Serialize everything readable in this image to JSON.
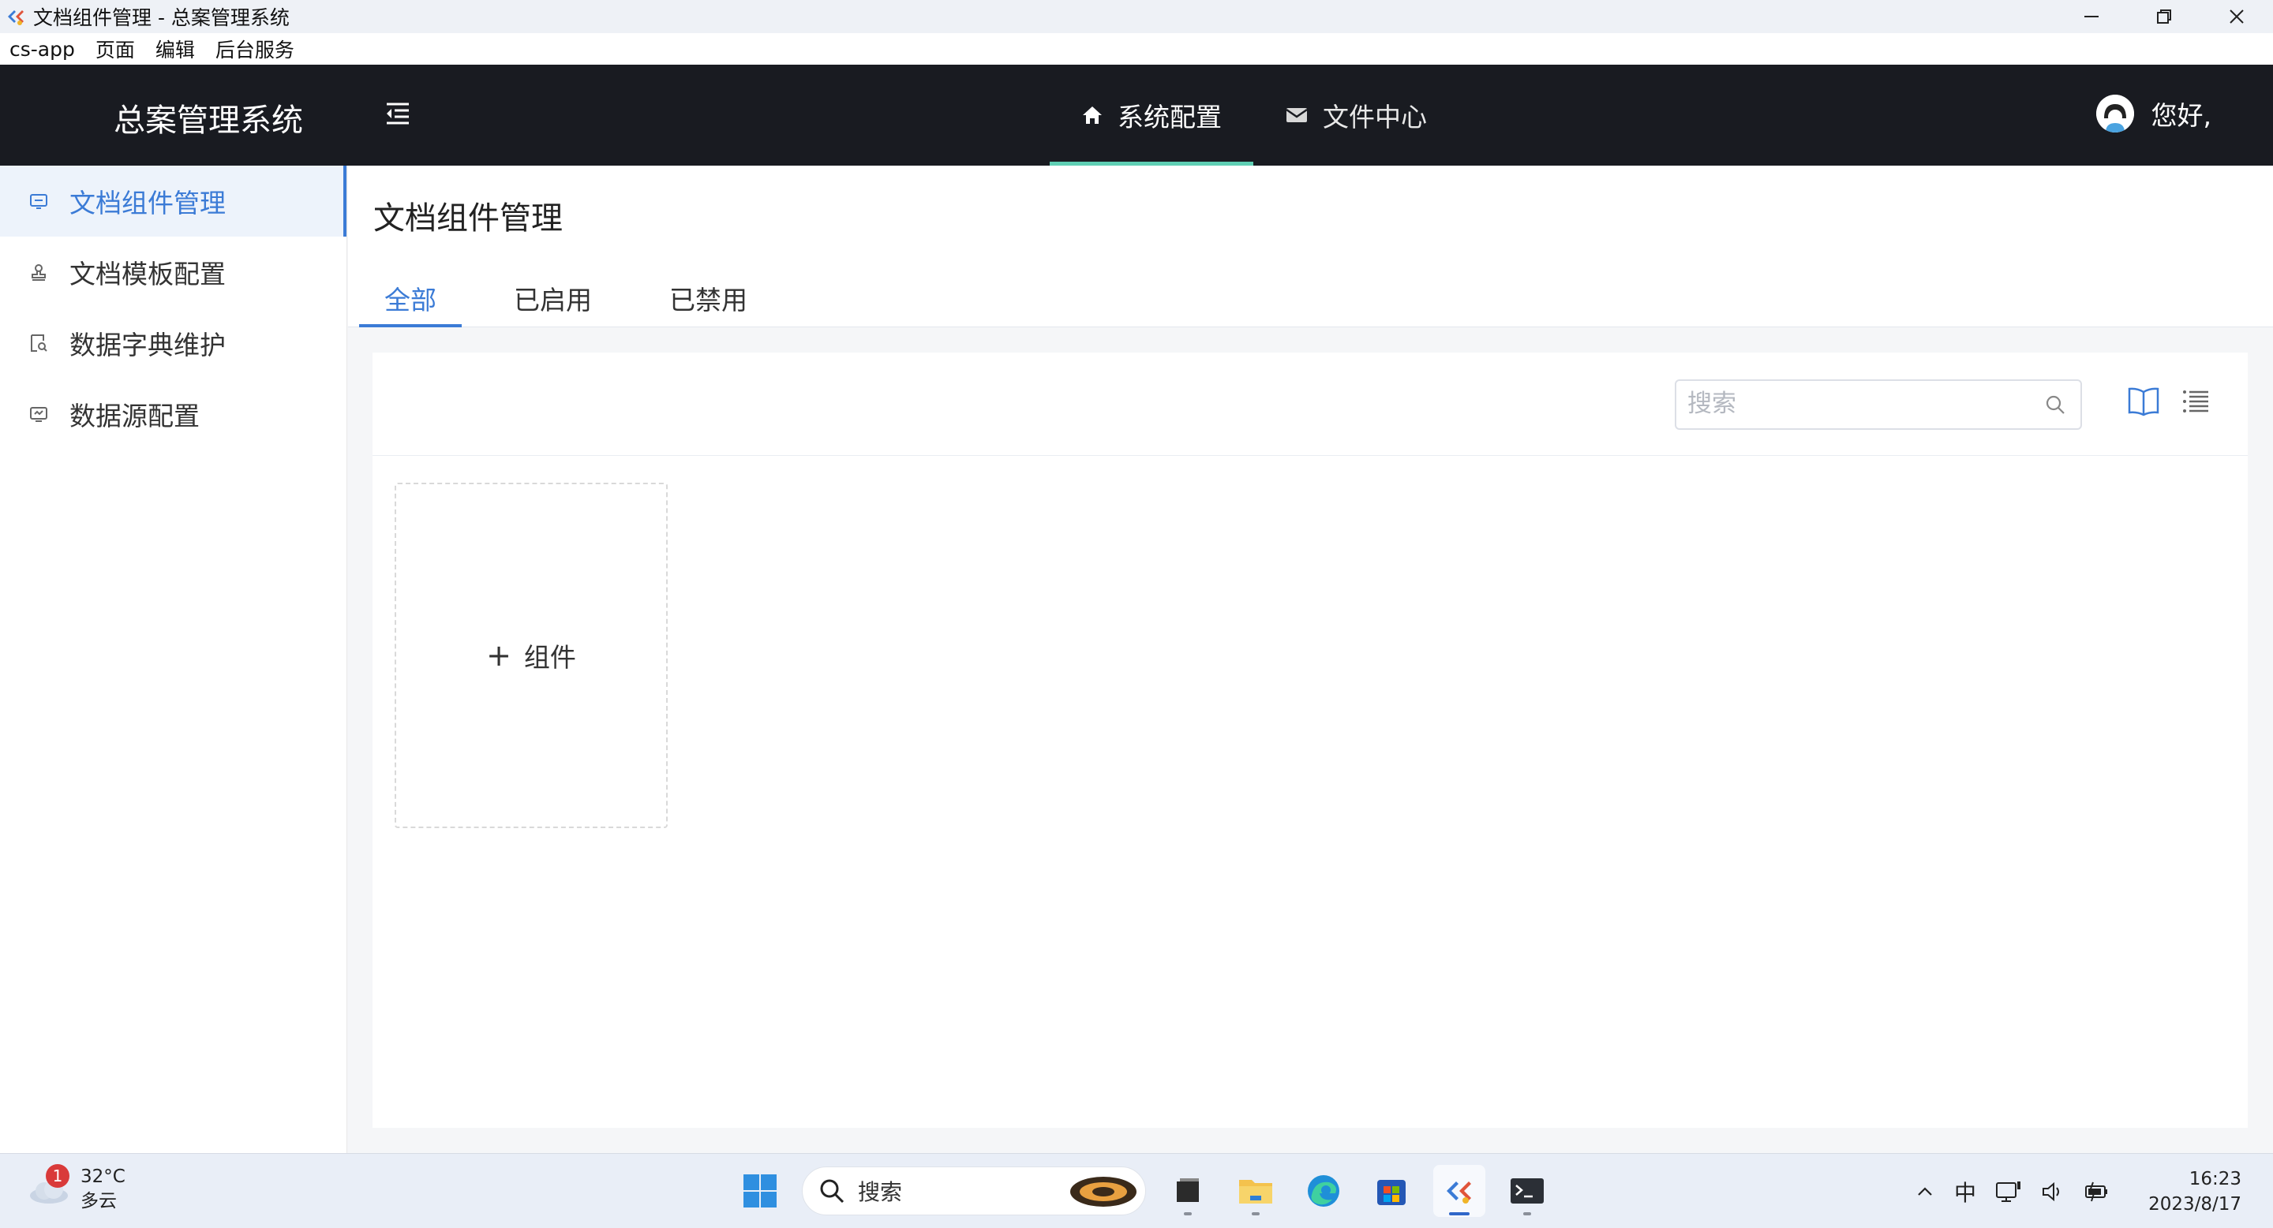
{
  "window": {
    "title": "文档组件管理 - 总案管理系统"
  },
  "menubar": {
    "items": [
      "cs-app",
      "页面",
      "编辑",
      "后台服务"
    ]
  },
  "header": {
    "brand": "总案管理系统",
    "nav": [
      {
        "label": "系统配置",
        "icon": "home-icon",
        "active": true
      },
      {
        "label": "文件中心",
        "icon": "mail-icon",
        "active": false
      }
    ],
    "greeting": "您好,",
    "accent_color": "#5fcfb4",
    "background_color": "#191b21"
  },
  "sidebar": {
    "items": [
      {
        "label": "文档组件管理",
        "icon": "component-icon",
        "active": true
      },
      {
        "label": "文档模板配置",
        "icon": "stamp-icon",
        "active": false
      },
      {
        "label": "数据字典维护",
        "icon": "dictionary-search-icon",
        "active": false
      },
      {
        "label": "数据源配置",
        "icon": "monitor-icon",
        "active": false
      }
    ],
    "active_color": "#3b7bd6"
  },
  "main": {
    "page_title": "文档组件管理",
    "tabs": [
      {
        "label": "全部",
        "active": true
      },
      {
        "label": "已启用",
        "active": false
      },
      {
        "label": "已禁用",
        "active": false
      }
    ],
    "search": {
      "placeholder": "搜索",
      "value": ""
    },
    "view_icons": [
      "book-icon",
      "list-icon"
    ],
    "add_card_label": "组件"
  },
  "taskbar": {
    "weather": {
      "temperature": "32°C",
      "condition": "多云",
      "badge": "1"
    },
    "search_label": "搜索",
    "apps": [
      "windows-start-icon",
      "file-explorer-icon",
      "folder-icon",
      "edge-icon",
      "store-icon",
      "cs-app-icon",
      "terminal-icon"
    ],
    "tray": {
      "ime": "中"
    },
    "clock": {
      "time": "16:23",
      "date": "2023/8/17"
    }
  }
}
